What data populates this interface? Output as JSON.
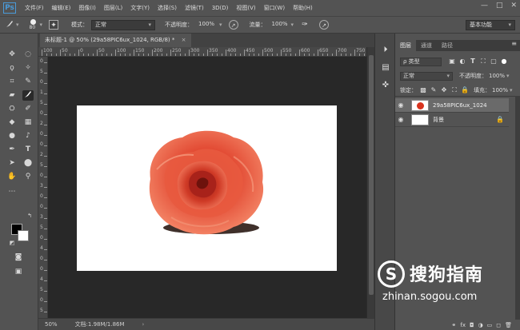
{
  "app": {
    "logo": "Ps"
  },
  "menu": [
    "文件(F)",
    "编辑(E)",
    "图像(I)",
    "图层(L)",
    "文字(Y)",
    "选择(S)",
    "滤镜(T)",
    "3D(D)",
    "视图(V)",
    "窗口(W)",
    "帮助(H)"
  ],
  "window_controls": [
    "—",
    "□",
    "✕"
  ],
  "options": {
    "brush_size": "80",
    "mode_label": "模式：",
    "mode_value": "正常",
    "opacity_label": "不透明度：",
    "opacity_value": "100%",
    "flow_label": "流量：",
    "flow_value": "100%",
    "workspace": "基本功能"
  },
  "document": {
    "tab_title": "未标题-1 @ 50% (29a58PIC6ux_1024, RGB/8) *",
    "tab_close": "×",
    "zoom": "50%",
    "doc_info": "文档:1.98M/1.86M",
    "ruler_h_labels": [
      "100",
      "50",
      "0",
      "50",
      "100",
      "150",
      "200",
      "250",
      "300",
      "350",
      "400",
      "450",
      "500",
      "550",
      "600",
      "650",
      "700",
      "750"
    ],
    "ruler_v_labels": [
      "0",
      "5",
      "0",
      "1",
      "5",
      "0",
      "2",
      "0",
      "0",
      "2",
      "5",
      "0",
      "3",
      "0",
      "0",
      "3",
      "5",
      "0",
      "4",
      "0",
      "0",
      "4",
      "5",
      "0",
      "5"
    ]
  },
  "layers_panel": {
    "tabs": [
      "图层",
      "通道",
      "路径"
    ],
    "filter_kind": "ρ 类型",
    "blend_mode": "正常",
    "opacity_label": "不透明度：",
    "opacity_value": "100%",
    "lock_label": "锁定：",
    "fill_label": "填充：",
    "fill_value": "100%",
    "layers": [
      {
        "name": "29a58PIC6ux_1024",
        "selected": true
      },
      {
        "name": "背景",
        "selected": false,
        "locked": true
      }
    ],
    "footer_icons": [
      "link-icon",
      "fx-icon",
      "mask-icon",
      "adjustment-icon",
      "folder-icon",
      "new-layer-icon",
      "trash-icon"
    ],
    "footer_glyphs": [
      "⚭",
      "fx",
      "◘",
      "◑",
      "▭",
      "◻",
      "🗑"
    ]
  },
  "watermark": {
    "logo_letter": "S",
    "title": "搜狗指南",
    "url": "zhinan.sogou.com"
  },
  "colors": {
    "accent": "#4a9ad8",
    "rose_dark": "#c2301f",
    "rose_light": "#f06a4e"
  }
}
